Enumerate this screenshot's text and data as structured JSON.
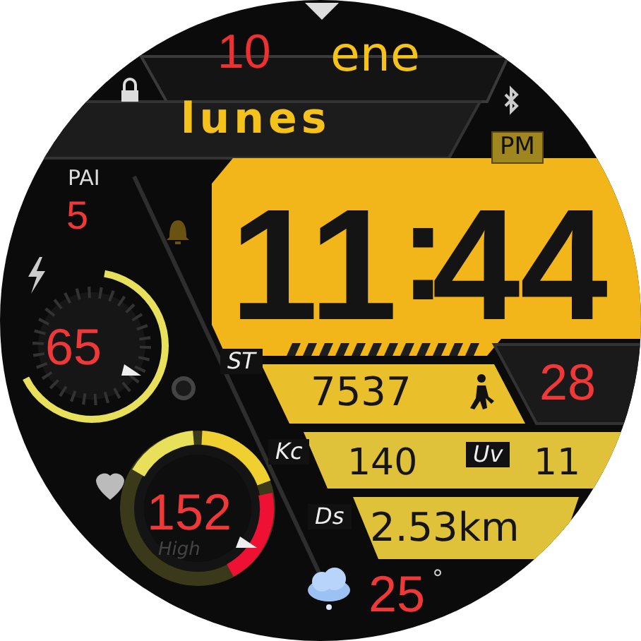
{
  "date": {
    "day": "10",
    "month": "ene",
    "weekday": "lunes"
  },
  "ampm": "PM",
  "time": {
    "hours": "11",
    "separator": ":",
    "minutes": "44"
  },
  "pai": {
    "label": "PAI",
    "value": "5"
  },
  "battery": {
    "value": "65",
    "level": 0.65
  },
  "steps": {
    "label": "ST",
    "value": "7537"
  },
  "side_value": "28",
  "calories": {
    "label": "Kc",
    "value": "140"
  },
  "uv": {
    "label": "Uv",
    "value": "11"
  },
  "distance": {
    "label": "Ds",
    "value": "2.53km"
  },
  "heart_rate": {
    "value": "152",
    "zone": "High"
  },
  "weather": {
    "temperature": "25",
    "unit": "°"
  }
}
